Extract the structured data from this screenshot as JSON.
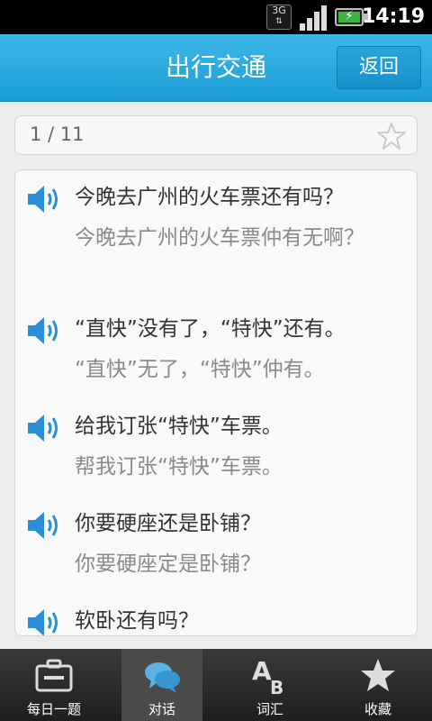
{
  "status_bar": {
    "network": "3G",
    "time": "14:19"
  },
  "header": {
    "title": "出行交通",
    "back_label": "返回"
  },
  "counter": {
    "text": "1 / 11"
  },
  "entries": [
    {
      "phrase": "今晚去广州的火车票还有吗？",
      "canto": "今晚去广州的火车票仲有无啊？"
    },
    {
      "phrase": "“直快”没有了，“特快”还有。",
      "canto": "“直快”无了，“特快”仲有。"
    },
    {
      "phrase": "给我订张“特快”车票。",
      "canto": "帮我订张“特快”车票。"
    },
    {
      "phrase": "你要硬座还是卧铺？",
      "canto": "你要硬座定是卧铺？"
    },
    {
      "phrase": "软卧还有吗？"
    }
  ],
  "bottom_nav": [
    {
      "label": "每日一题",
      "icon": "briefcase-icon"
    },
    {
      "label": "对话",
      "icon": "chat-bubbles-icon",
      "active": true
    },
    {
      "label": "词汇",
      "icon": "ab-letters-icon"
    },
    {
      "label": "收藏",
      "icon": "star-icon"
    }
  ],
  "colors": {
    "header": "#1a9dd6",
    "speaker": "#2a8fd6"
  }
}
